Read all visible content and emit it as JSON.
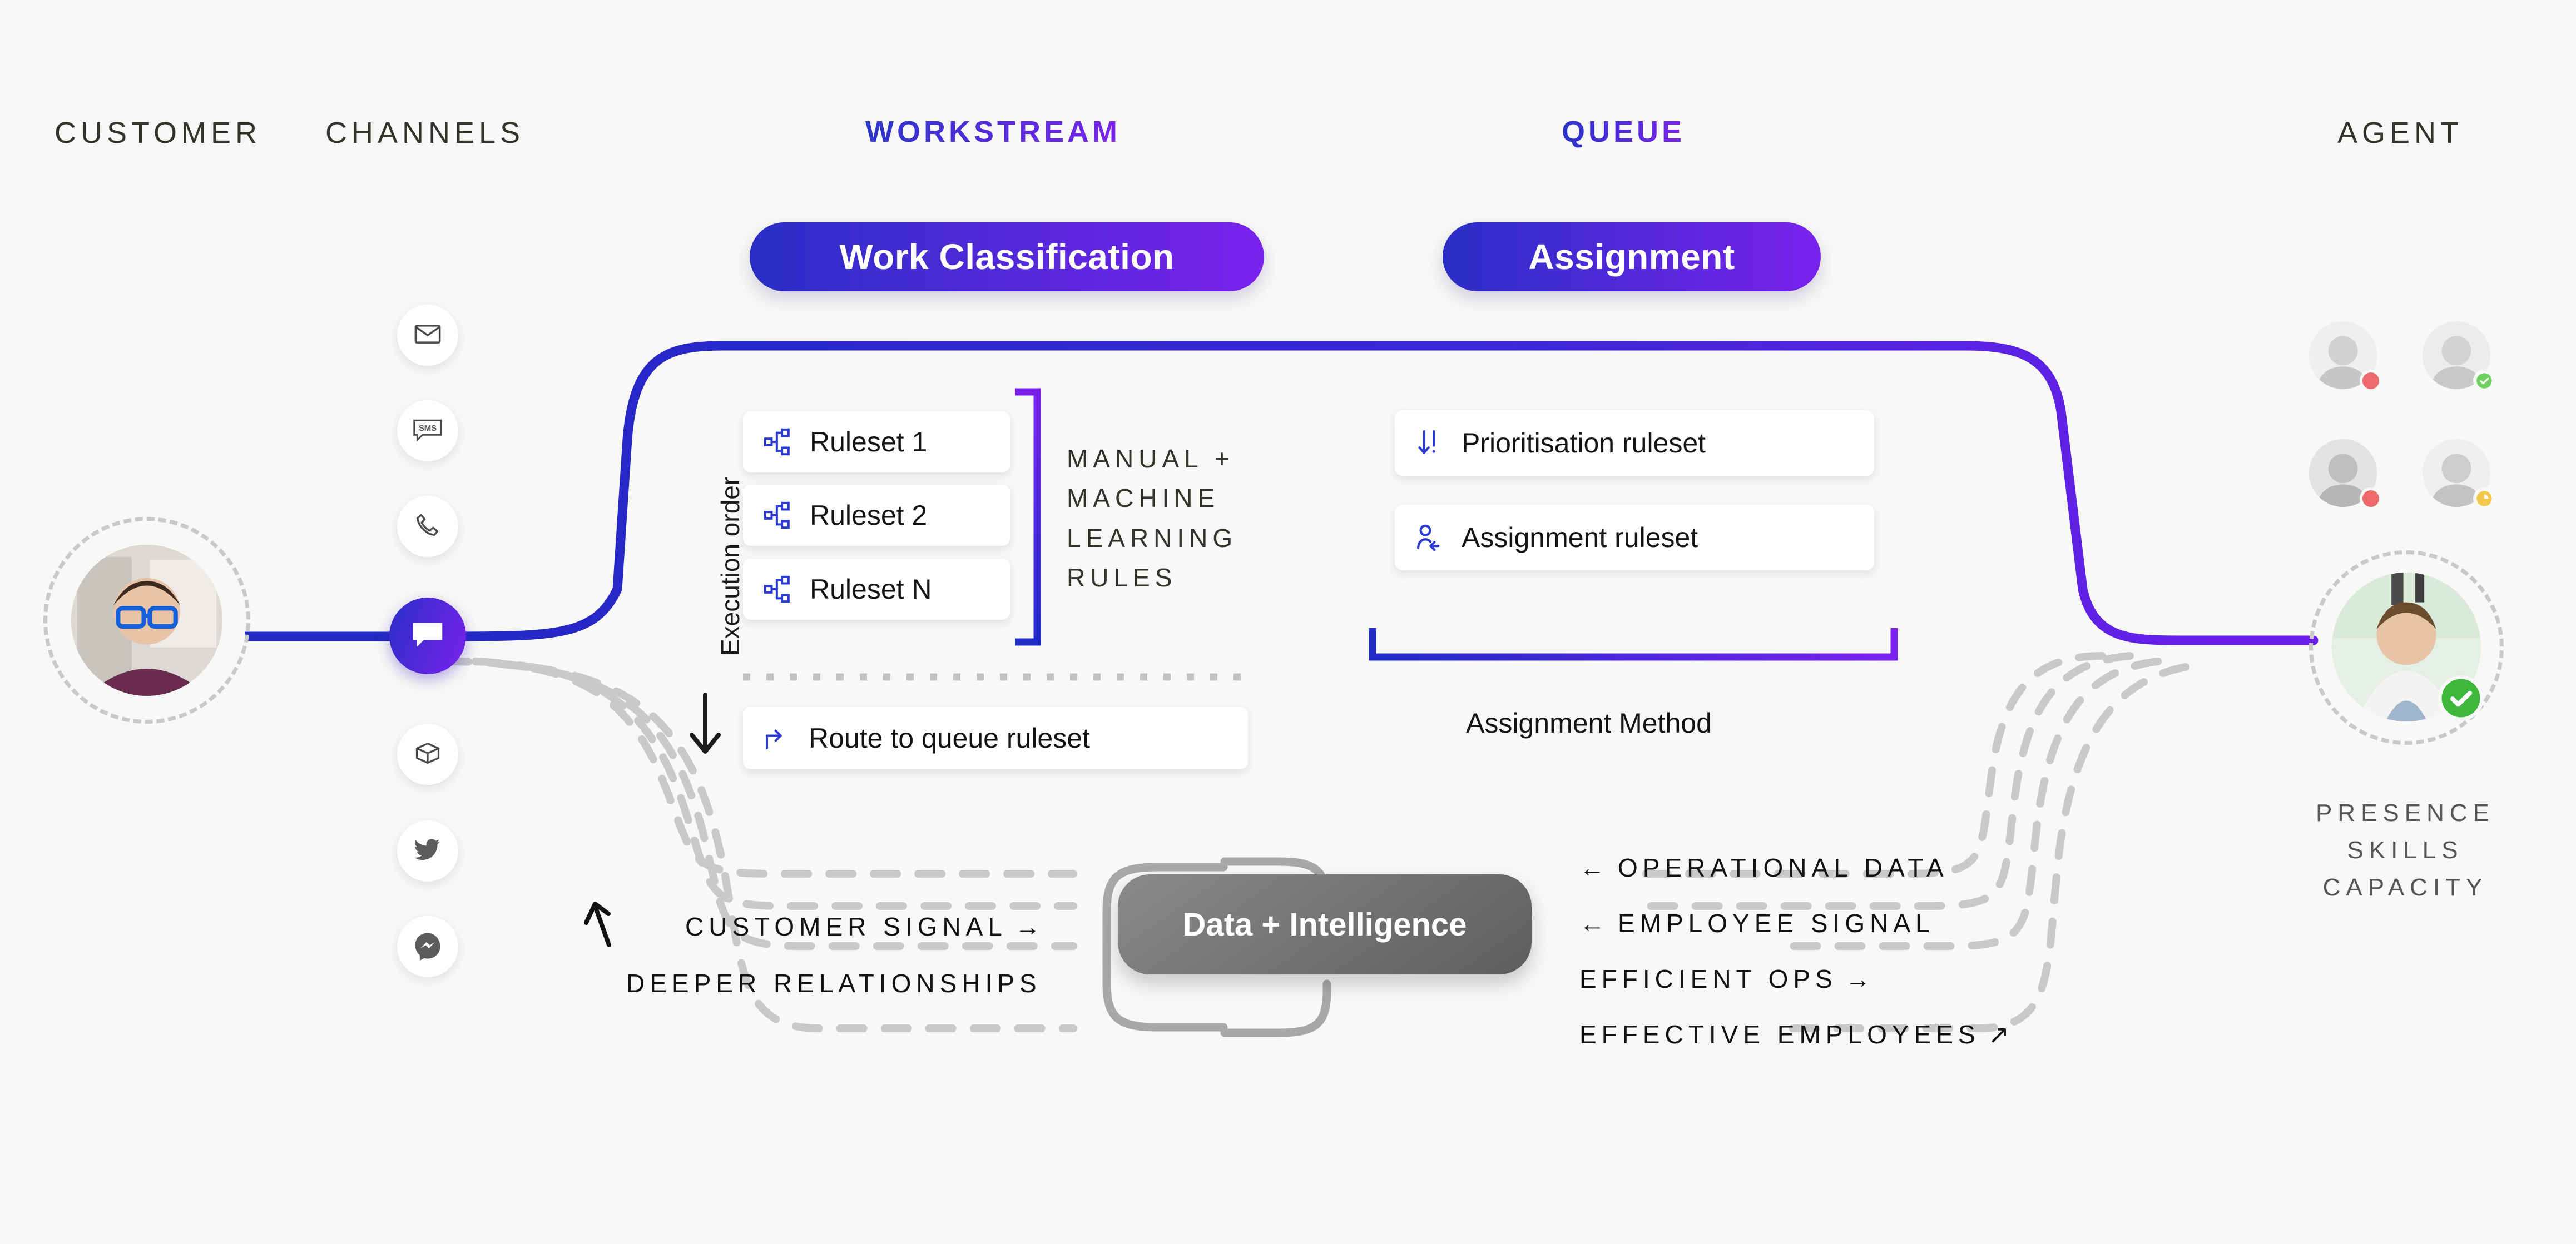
{
  "columns": [
    {
      "id": "customer",
      "label": "CUSTOMER",
      "accent": false
    },
    {
      "id": "channels",
      "label": "CHANNELS",
      "accent": false
    },
    {
      "id": "workstream",
      "label": "WORKSTREAM",
      "accent": true
    },
    {
      "id": "queue",
      "label": "QUEUE",
      "accent": true
    },
    {
      "id": "agent",
      "label": "AGENT",
      "accent": false
    }
  ],
  "pills": {
    "work_classification": "Work Classification",
    "assignment": "Assignment"
  },
  "channels": [
    {
      "name": "email-channel",
      "icon": "envelope-icon",
      "active": false
    },
    {
      "name": "sms-channel",
      "icon": "sms-icon",
      "active": false
    },
    {
      "name": "voice-channel",
      "icon": "phone-icon",
      "active": false
    },
    {
      "name": "chat-channel",
      "icon": "chat-icon",
      "active": true
    },
    {
      "name": "package-channel",
      "icon": "package-icon",
      "active": false
    },
    {
      "name": "twitter-channel",
      "icon": "twitter-icon",
      "active": false
    },
    {
      "name": "messenger-channel",
      "icon": "messenger-icon",
      "active": false
    }
  ],
  "workstream": {
    "execution_order_label": "Execution order",
    "rulesets": [
      {
        "label": "Ruleset 1",
        "icon": "sitemap-icon"
      },
      {
        "label": "Ruleset 2",
        "icon": "sitemap-icon"
      },
      {
        "label": "Ruleset N",
        "icon": "sitemap-icon"
      }
    ],
    "rules_caption": "MANUAL +\nMACHINE\nLEARNING\nRULES",
    "route_card": {
      "label": "Route to queue ruleset",
      "icon": "route-arrow-icon"
    }
  },
  "queue": {
    "cards": [
      {
        "label": "Prioritisation ruleset",
        "icon": "priority-down-icon"
      },
      {
        "label": "Assignment ruleset",
        "icon": "user-assign-icon"
      }
    ],
    "bracket_caption": "Assignment Method"
  },
  "agent": {
    "roster": [
      {
        "name": "agent-avatar-1",
        "status": "busy"
      },
      {
        "name": "agent-avatar-2",
        "status": "available"
      },
      {
        "name": "agent-avatar-3",
        "status": "busy"
      },
      {
        "name": "agent-avatar-4",
        "status": "away"
      }
    ],
    "featured": {
      "name": "featured-agent-avatar",
      "status": "available"
    },
    "attributes": "PRESENCE\nSKILLS\nCAPACITY"
  },
  "intelligence": {
    "pill_label": "Data + Intelligence",
    "left_flows": [
      {
        "label": "CUSTOMER SIGNAL",
        "arrow": "right"
      },
      {
        "label": "DEEPER RELATIONSHIPS",
        "arrow": "none"
      }
    ],
    "right_flows": [
      {
        "label": "OPERATIONAL DATA",
        "arrow": "left"
      },
      {
        "label": "EMPLOYEE SIGNAL",
        "arrow": "left"
      },
      {
        "label": "EFFICIENT OPS",
        "arrow": "right"
      },
      {
        "label": "EFFECTIVE EMPLOYEES",
        "arrow": "right-up"
      }
    ]
  },
  "colors": {
    "background": "#f8f8f6",
    "gradient_start": "#2a2ec6",
    "gradient_end": "#7a22ec",
    "flow_line_start": "#2127c4",
    "flow_line_end": "#6d1eea",
    "dashed_gray": "#c9c9c7",
    "status_busy": "#ec6a6a",
    "status_available": "#3db83d",
    "status_away": "#f2c94c",
    "intelligence_pill": "#6d6d6d"
  }
}
